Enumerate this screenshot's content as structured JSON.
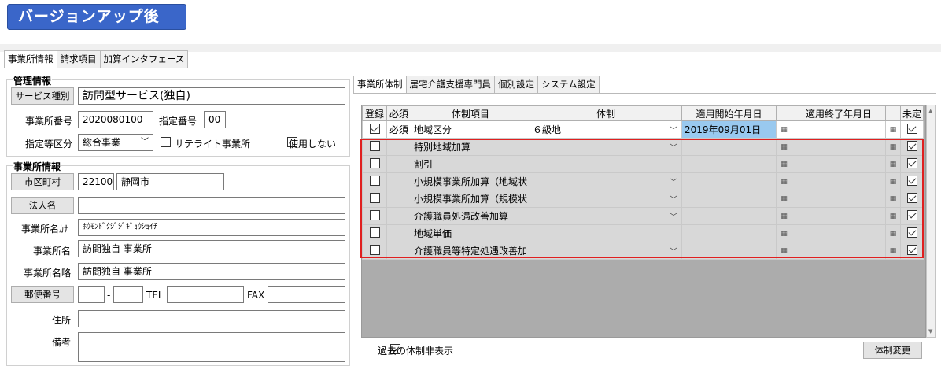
{
  "banner": {
    "title": "バージョンアップ後"
  },
  "main_tabs": [
    "事業所情報",
    "請求項目",
    "加算インタフェース"
  ],
  "mgmt": {
    "title": "管理情報",
    "service_type_btn": "サービス種別",
    "service_type": "訪問型サービス(独自)",
    "office_no_label": "事業所番号",
    "office_no": "2020080100",
    "designation_no_label": "指定番号",
    "designation_no": "00",
    "designation_class_label": "指定等区分",
    "designation_class": "総合事業",
    "satellite_label": "サテライト事業所",
    "unused_label": "使用しない"
  },
  "office": {
    "title": "事業所情報",
    "city_btn": "市区町村",
    "city_code": "22100",
    "city_name": "静岡市",
    "corp_btn": "法人名",
    "corp_name": "",
    "kana_label": "事業所名ｶﾅ",
    "kana": "ﾎｳﾓﾝﾄﾞｸｼﾞｼﾞｷﾞｮｳｼｮｲﾁ",
    "name_label": "事業所名",
    "name": "訪問独自 事業所",
    "short_label": "事業所名略",
    "short": "訪問独自 事業所",
    "zip_btn": "郵便番号",
    "dash": "-",
    "tel_label": "TEL",
    "fax_label": "FAX",
    "addr_label": "住所",
    "note_label": "備考"
  },
  "right_tabs": [
    "事業所体制",
    "居宅介護支援専門員",
    "個別設定",
    "システム設定"
  ],
  "grid": {
    "headers": [
      "登録",
      "必須",
      "体制項目",
      "体制",
      "適用開始年月日",
      "",
      "適用終了年月日",
      "",
      "未定"
    ],
    "rows": [
      {
        "reg": true,
        "req": "必須",
        "item": "地域区分",
        "value": "６級地",
        "dd": true,
        "start": "2019年09月01日",
        "end": "",
        "undecided": true,
        "white": true
      },
      {
        "reg": false,
        "req": "",
        "item": "特別地域加算",
        "value": "",
        "dd": true,
        "start": "",
        "end": "",
        "undecided": true
      },
      {
        "reg": false,
        "req": "",
        "item": "割引",
        "value": "",
        "dd": false,
        "start": "",
        "end": "",
        "undecided": true
      },
      {
        "reg": false,
        "req": "",
        "item": "小規模事業所加算（地域状",
        "value": "",
        "dd": true,
        "start": "",
        "end": "",
        "undecided": true
      },
      {
        "reg": false,
        "req": "",
        "item": "小規模事業所加算（規模状",
        "value": "",
        "dd": true,
        "start": "",
        "end": "",
        "undecided": true
      },
      {
        "reg": false,
        "req": "",
        "item": "介護職員処遇改善加算",
        "value": "",
        "dd": true,
        "start": "",
        "end": "",
        "undecided": true
      },
      {
        "reg": false,
        "req": "",
        "item": "地域単価",
        "value": "",
        "dd": false,
        "start": "",
        "end": "",
        "undecided": true
      },
      {
        "reg": false,
        "req": "",
        "item": "介護職員等特定処遇改善加",
        "value": "",
        "dd": true,
        "start": "",
        "end": "",
        "undecided": true
      }
    ]
  },
  "hide_past_label": "過去の体制非表示",
  "change_btn": "体制変更",
  "icons": {
    "calendar": "calendar-icon",
    "dropdown": "chevron-down-icon"
  },
  "colors": {
    "banner": "#3a66c9",
    "highlight": "#e02020",
    "selection": "#99c9ef"
  }
}
